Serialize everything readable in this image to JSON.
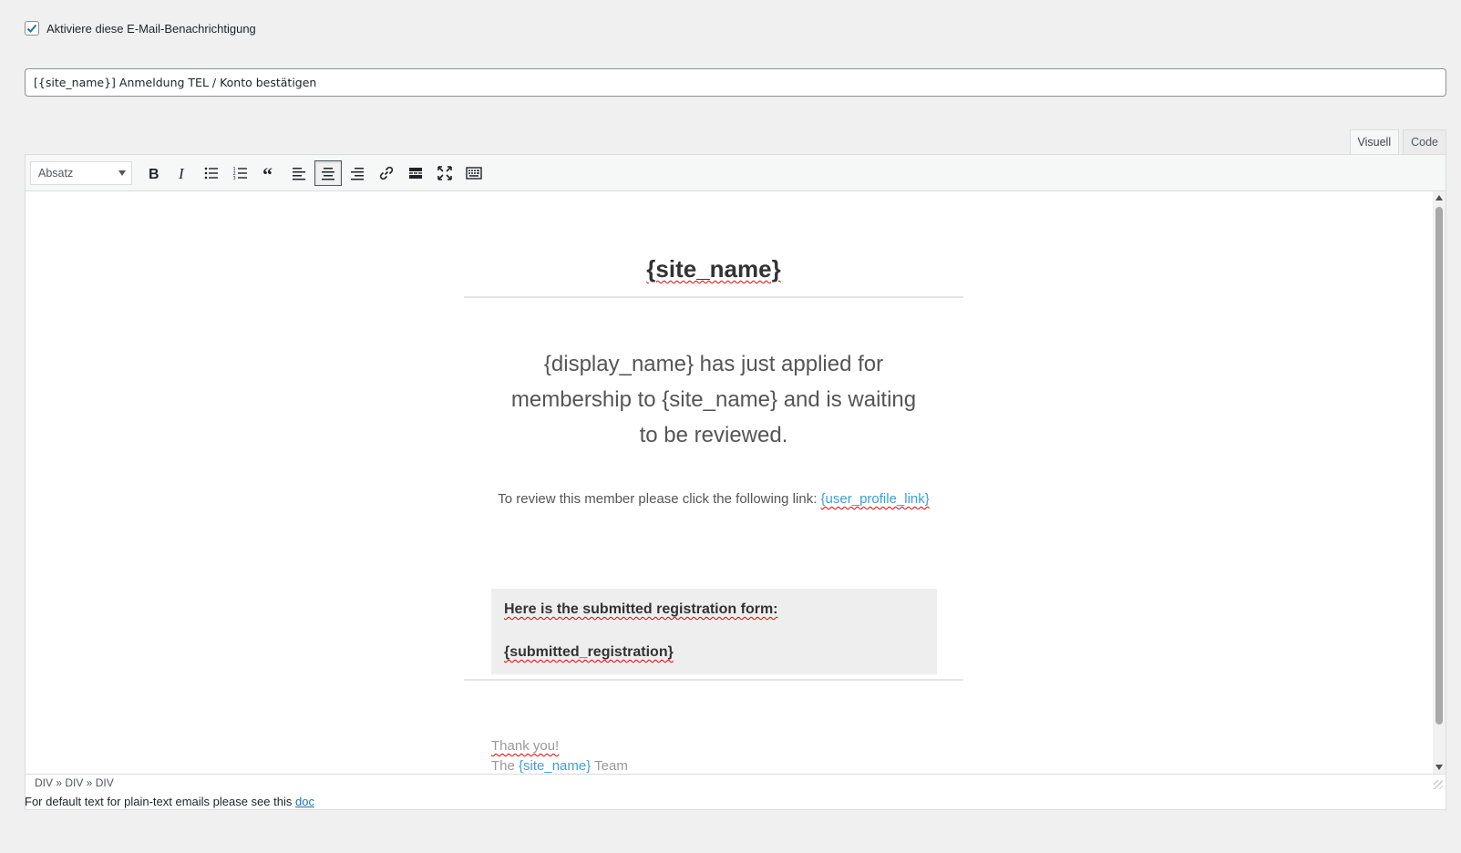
{
  "notification": {
    "enable_label": "Aktiviere diese E-Mail-Benachrichtigung",
    "enabled": true
  },
  "subject": {
    "value": "[{site_name}] Anmeldung TEL / Konto bestätigen"
  },
  "editor_tabs": [
    {
      "label": "Visuell",
      "active": true
    },
    {
      "label": "Code",
      "active": false
    }
  ],
  "toolbar": {
    "format_select": "Absatz",
    "buttons": [
      "bold-icon",
      "italic-icon",
      "bullet-list-icon",
      "numbered-list-icon",
      "blockquote-icon",
      "align-left-icon",
      "align-center-icon",
      "align-right-icon",
      "link-icon",
      "read-more-icon",
      "fullscreen-icon",
      "toolbar-toggle-icon"
    ],
    "active_button": "align-center-icon"
  },
  "email_content": {
    "site_title": "{site_name}",
    "lead_text": "{display_name} has just applied for membership to {site_name} and is waiting to be reviewed.",
    "review_text": "To review this member please click the following link: ",
    "review_link": "{user_profile_link}",
    "registration_heading": "Here is the submitted registration form:",
    "registration_placeholder": "{submitted_registration}",
    "thanks": "Thank you!",
    "team_prefix": "The ",
    "team_site": "{site_name}",
    "team_suffix": " Team"
  },
  "statusbar": {
    "path": "DIV » DIV » DIV"
  },
  "note": {
    "text": "For default text for plain-text emails please see this ",
    "link": "doc"
  },
  "colors": {
    "background": "#f0f0f1",
    "link": "#3ba1da",
    "admin_link": "#2271b1"
  }
}
